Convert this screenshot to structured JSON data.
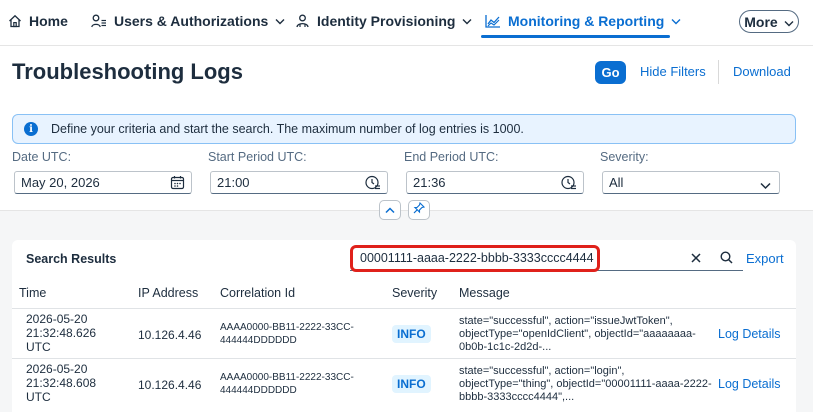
{
  "nav": {
    "home": "Home",
    "users": "Users & Authorizations",
    "identity": "Identity Provisioning",
    "monitoring": "Monitoring & Reporting",
    "more": "More"
  },
  "header": {
    "title": "Troubleshooting Logs",
    "go": "Go",
    "hide_filters": "Hide Filters",
    "download": "Download"
  },
  "info": {
    "text": "Define your criteria and start the search. The maximum number of log entries is 1000."
  },
  "filters": {
    "date": {
      "label": "Date UTC:",
      "value": "May 20, 2026"
    },
    "start": {
      "label": "Start Period UTC:",
      "value": "21:00"
    },
    "end": {
      "label": "End Period UTC:",
      "value": "21:36"
    },
    "severity": {
      "label": "Severity:",
      "value": "All"
    }
  },
  "results": {
    "title": "Search Results",
    "search_value": "00001111-aaaa-2222-bbbb-3333cccc4444",
    "export": "Export",
    "columns": {
      "time": "Time",
      "ip": "IP Address",
      "correlation": "Correlation Id",
      "severity": "Severity",
      "message": "Message"
    },
    "rows": [
      {
        "time1": "2026-05-20",
        "time2": "21:32:48.626",
        "time3": "UTC",
        "ip": "10.126.4.46",
        "corr1": "AAAA0000-BB11-2222-33CC-",
        "corr2": "444444DDDDDD",
        "severity": "INFO",
        "message": "state=\"successful\", action=\"issueJwtToken\", objectType=\"openIdClient\", objectId=\"aaaaaaaa-0b0b-1c1c-2d2d-...",
        "details": "Log Details"
      },
      {
        "time1": "2026-05-20",
        "time2": "21:32:48.608",
        "time3": "UTC",
        "ip": "10.126.4.46",
        "corr1": "AAAA0000-BB11-2222-33CC-",
        "corr2": "444444DDDDDD",
        "severity": "INFO",
        "message": "state=\"successful\", action=\"login\", objectType=\"thing\", objectId=\"00001111-aaaa-2222-bbbb-3333cccc4444\",...",
        "details": "Log Details"
      }
    ]
  },
  "colors": {
    "accent": "#0a6ed1",
    "highlight": "#e0211b",
    "info_bg": "#e8f3ff"
  },
  "icons": [
    "home-icon",
    "users-icon",
    "identity-icon",
    "chart-icon",
    "chevron-down-icon",
    "calendar-icon",
    "clock-icon",
    "info-icon",
    "collapse-icon",
    "pin-icon",
    "clear-icon",
    "search-icon"
  ]
}
